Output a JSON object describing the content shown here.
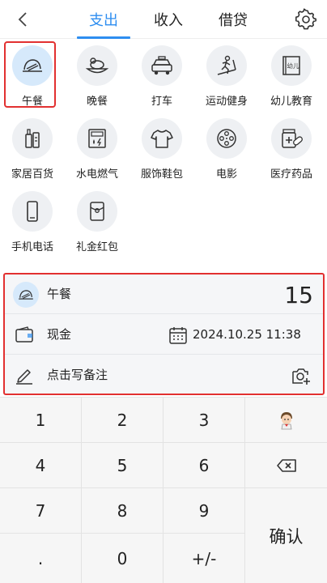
{
  "header": {
    "tabs": [
      {
        "label": "支出",
        "active": true
      },
      {
        "label": "收入",
        "active": false
      },
      {
        "label": "借贷",
        "active": false
      }
    ],
    "accent_color": "#2e8ef0"
  },
  "categories": [
    {
      "label": "午餐",
      "icon": "lunch-icon",
      "selected": true
    },
    {
      "label": "晚餐",
      "icon": "dinner-icon"
    },
    {
      "label": "打车",
      "icon": "taxi-icon"
    },
    {
      "label": "运动健身",
      "icon": "fitness-icon"
    },
    {
      "label": "幼儿教育",
      "icon": "education-book-icon"
    },
    {
      "label": "家居百货",
      "icon": "household-icon"
    },
    {
      "label": "水电燃气",
      "icon": "utilities-icon"
    },
    {
      "label": "服饰鞋包",
      "icon": "clothing-icon"
    },
    {
      "label": "电影",
      "icon": "film-reel-icon"
    },
    {
      "label": "医疗药品",
      "icon": "medicine-icon"
    },
    {
      "label": "手机电话",
      "icon": "phone-icon"
    },
    {
      "label": "礼金红包",
      "icon": "red-envelope-icon"
    }
  ],
  "education_icon_text": "幼儿",
  "detail": {
    "category": "午餐",
    "amount": "15",
    "account": "现金",
    "datetime": "2024.10.25 11:38",
    "note_placeholder": "点击写备注"
  },
  "keypad": {
    "k1": "1",
    "k2": "2",
    "k3": "3",
    "k4": "4",
    "k5": "5",
    "k6": "6",
    "k7": "7",
    "k8": "8",
    "k9": "9",
    "dot": ".",
    "k0": "0",
    "sign": "+/-",
    "confirm": "确认"
  }
}
